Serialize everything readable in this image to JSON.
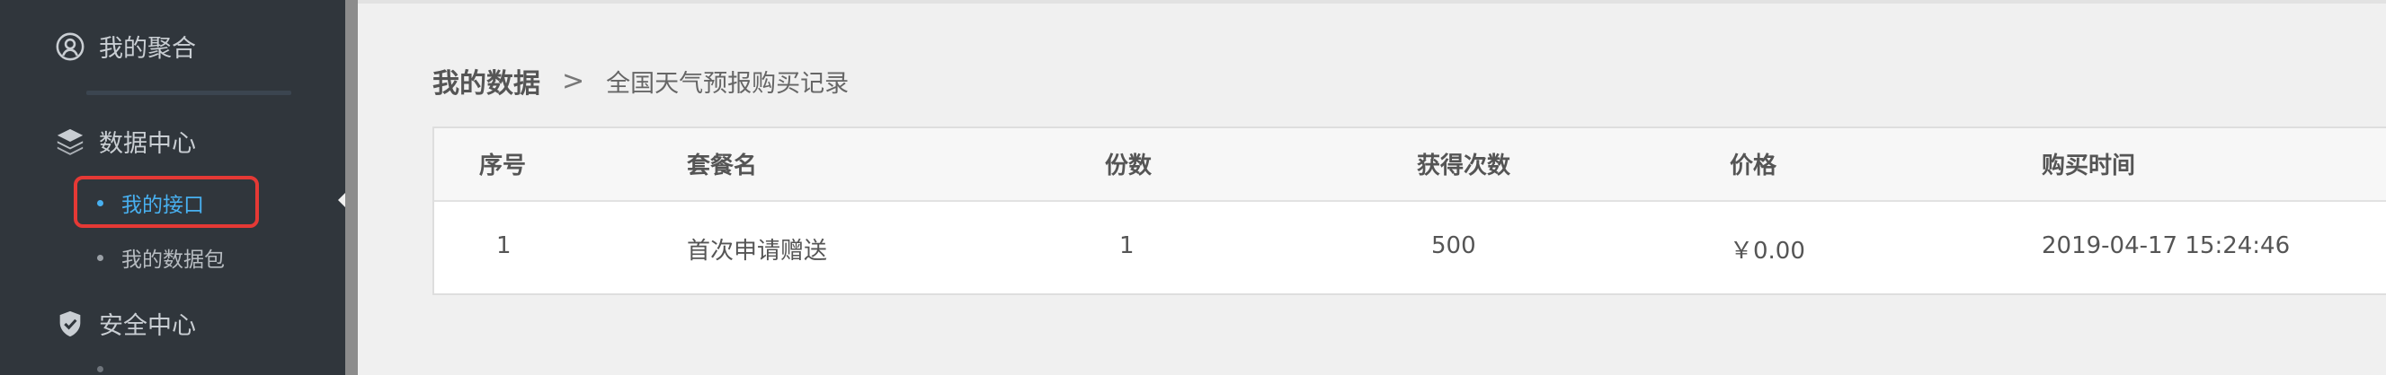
{
  "sidebar": {
    "aggregate_label": "我的聚合",
    "data_center_label": "数据中心",
    "sub_items": [
      {
        "label": "我的接口",
        "active": true
      },
      {
        "label": "我的数据包",
        "active": false
      }
    ],
    "security_label": "安全中心",
    "accent_color": "#48b0f0",
    "highlight_color": "#e53935"
  },
  "breadcrumb": {
    "main": "我的数据",
    "separator": ">",
    "current": "全国天气预报购买记录"
  },
  "table": {
    "headers": [
      "序号",
      "套餐名",
      "份数",
      "获得次数",
      "价格",
      "购买时间"
    ],
    "rows": [
      [
        "1",
        "首次申请赠送",
        "1",
        "500",
        "￥0.00",
        "2019-04-17 15:24:46"
      ]
    ]
  }
}
